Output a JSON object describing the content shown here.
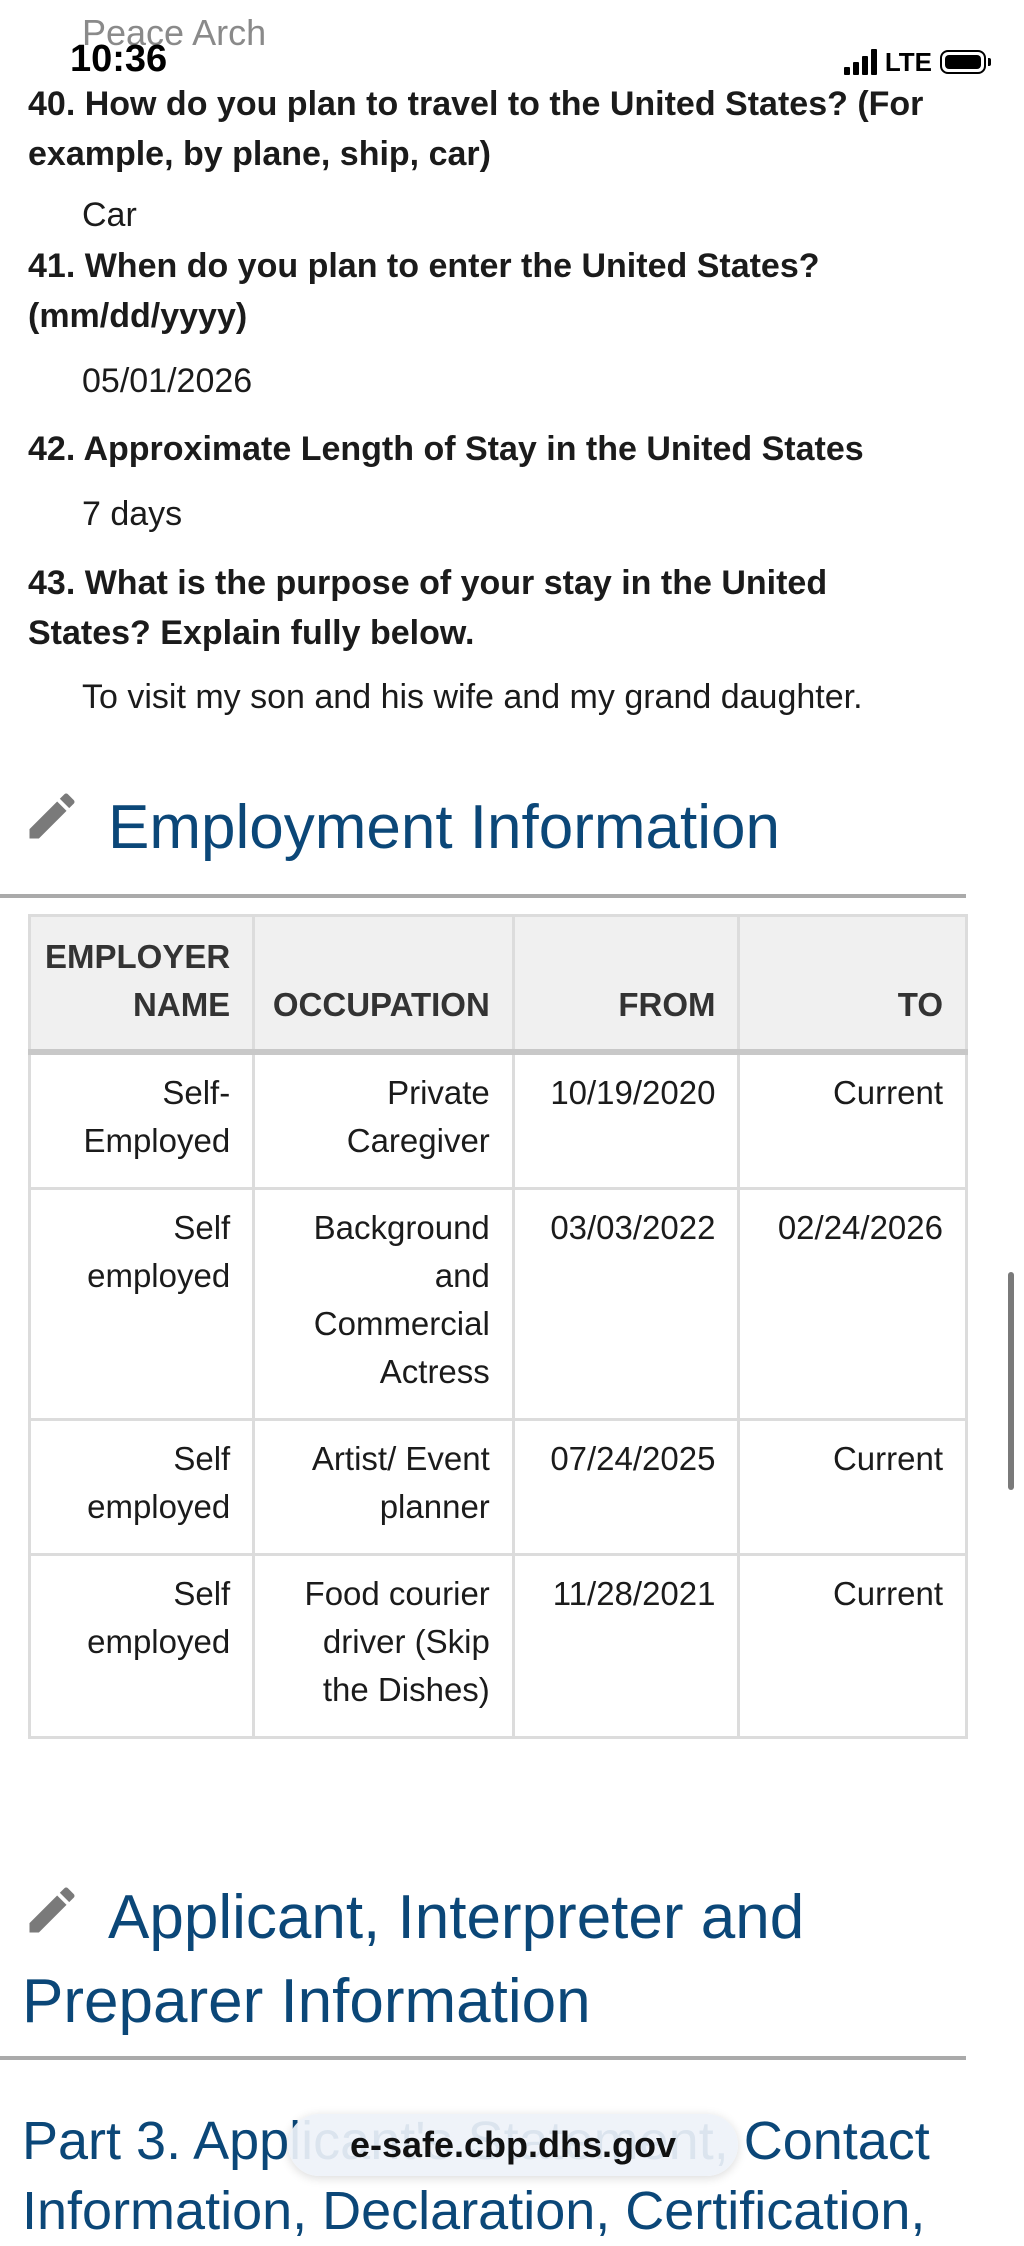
{
  "status_bar": {
    "overlay_title": "Peace Arch",
    "time": "10:36",
    "network": "LTE"
  },
  "travel": {
    "q40": {
      "question": "40. How do you plan to travel to the United States? (For example, by plane, ship, car)",
      "answer": "Car"
    },
    "q41": {
      "question": "41. When do you plan to enter the United States? (mm/dd/yyyy)",
      "answer": "05/01/2026"
    },
    "q42": {
      "question": "42. Approximate Length of Stay in the United States",
      "answer": "7 days"
    },
    "q43": {
      "question": "43. What is the purpose of your stay in the United States? Explain fully below.",
      "answer": "To visit my son and his wife and my grand daughter."
    }
  },
  "employment": {
    "title": "Employment Information",
    "columns": [
      "EMPLOYER NAME",
      "OCCUPATION",
      "FROM",
      "TO"
    ],
    "rows": [
      [
        "Self-Employed",
        "Private Caregiver",
        "10/19/2020",
        "Current"
      ],
      [
        "Self employed",
        "Background and Commercial Actress",
        "03/03/2022",
        "02/24/2026"
      ],
      [
        "Self employed",
        "Artist/ Event planner",
        "07/24/2025",
        "Current"
      ],
      [
        "Self employed",
        "Food courier driver (Skip the Dishes)",
        "11/28/2021",
        "Current"
      ]
    ]
  },
  "applicant": {
    "title": "Applicant, Interpreter and Preparer Information"
  },
  "part3": {
    "title": "Part 3. Applicant's Statement, Contact Information, Declaration, Certification,"
  },
  "browser": {
    "url": "e-safe.cbp.dhs.gov"
  },
  "icons": {
    "section": "pencil-icon",
    "signal": "signal-bars-icon",
    "battery": "battery-icon"
  },
  "colors": {
    "heading": "#0b4778",
    "rule": "#aaaaaa",
    "table_header_bg": "#f0f0f0"
  }
}
